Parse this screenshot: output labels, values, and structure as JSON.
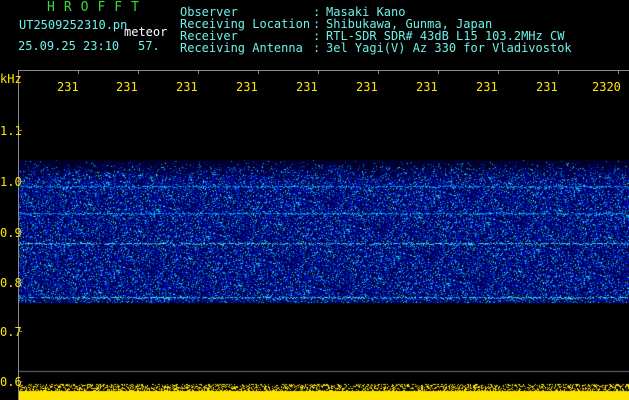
{
  "header": {
    "app_title": "HROFFT",
    "file_name": "UT2509252310.pn",
    "meteor_label": "meteor",
    "date_time": "25.09.25 23:10",
    "count": "57."
  },
  "info": [
    {
      "key": "Observer",
      "value": "Masaki Kano"
    },
    {
      "key": "Receiving Location",
      "value": "Shibukawa, Gunma, Japan"
    },
    {
      "key": "Receiver",
      "value": "RTL-SDR SDR# 43dB L15 103.2MHz CW"
    },
    {
      "key": "Receiving Antenna",
      "value": "3el Yagi(V) Az 330 for Vladivostok"
    }
  ],
  "separator": ":",
  "axis": {
    "y_unit": "kHz",
    "y_labels": [
      "1.1",
      "1.0",
      "0.9",
      "0.8",
      "0.7",
      "0.6"
    ],
    "x_labels": [
      "231",
      "231",
      "231",
      "231",
      "231",
      "231",
      "231",
      "231",
      "231",
      "2320"
    ]
  },
  "colors": {
    "background": "#000000",
    "text_green": "#3bd63b",
    "text_cyan": "#6ef0e8",
    "axis_yellow": "#ffe600"
  }
}
